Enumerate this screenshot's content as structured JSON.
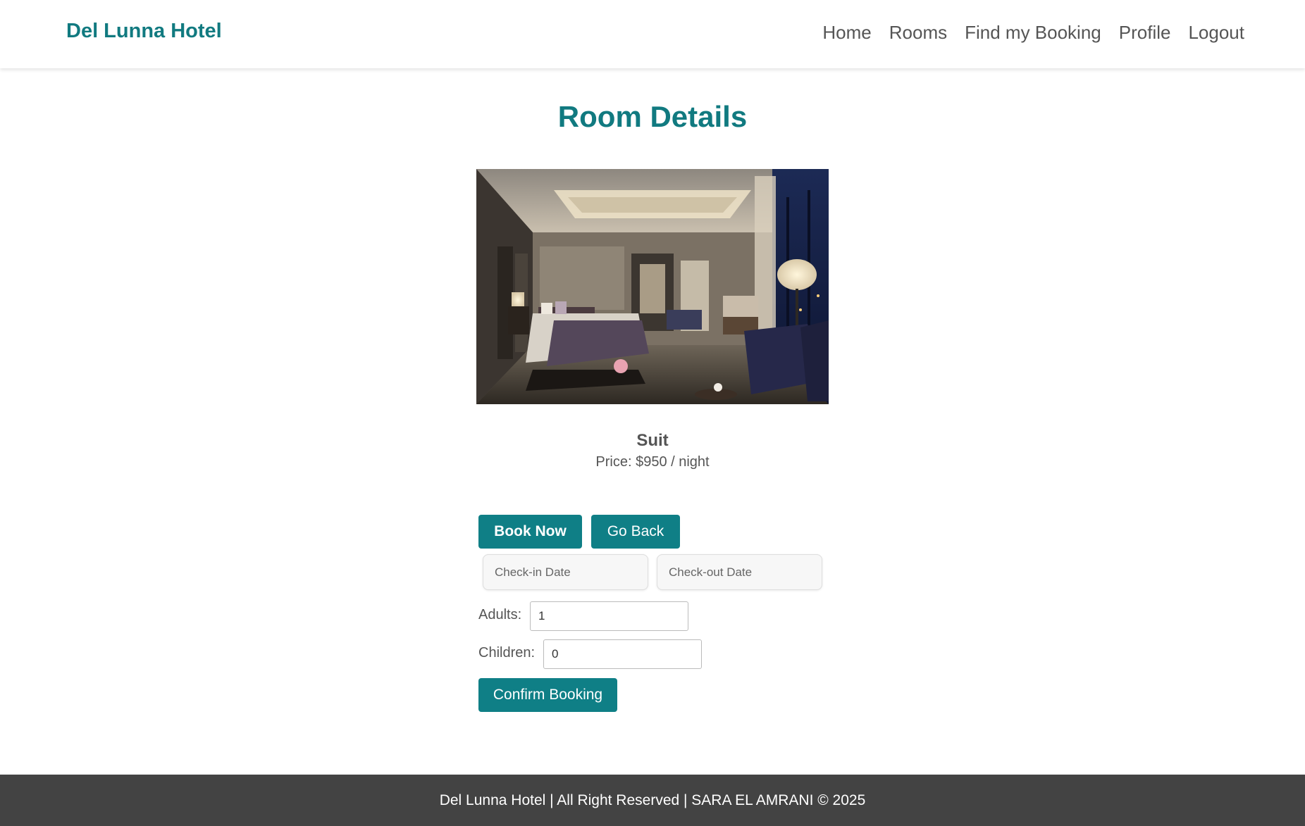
{
  "header": {
    "brand": "Del Lunna Hotel",
    "nav": [
      "Home",
      "Rooms",
      "Find my Booking",
      "Profile",
      "Logout"
    ]
  },
  "main": {
    "title": "Room Details",
    "room_name": "Suit",
    "room_price": "Price: $950 / night",
    "book_now_label": "Book Now",
    "go_back_label": "Go Back",
    "checkin_placeholder": "Check-in Date",
    "checkout_placeholder": "Check-out Date",
    "adults_label": "Adults:",
    "adults_value": "1",
    "children_label": "Children:",
    "children_value": "0",
    "confirm_label": "Confirm Booking"
  },
  "footer": {
    "text": "Del Lunna Hotel | All Right Reserved | SARA EL AMRANI © 2025"
  },
  "colors": {
    "accent": "#0f7f86",
    "brand_text": "#117a80",
    "footer_bg": "#434343"
  }
}
